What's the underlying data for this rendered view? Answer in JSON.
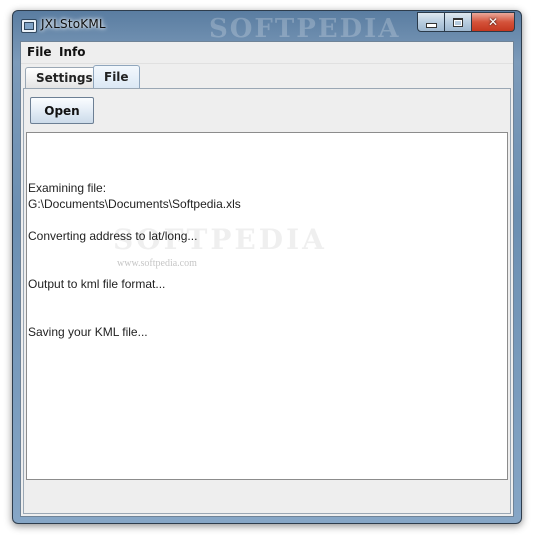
{
  "window": {
    "title": "JXLStoKML",
    "watermark": "SOFTPEDIA"
  },
  "menubar": {
    "items": [
      {
        "label": "File"
      },
      {
        "label": "Info"
      }
    ]
  },
  "tabs": [
    {
      "label": "Settings",
      "active": false
    },
    {
      "label": "File",
      "active": true
    }
  ],
  "file_tab": {
    "open_button_label": "Open",
    "log_lines": [
      "Examining file:",
      "G:\\Documents\\Documents\\Softpedia.xls",
      "Converting address to lat/long...",
      "Output to kml file format...",
      "Saving your KML file..."
    ],
    "watermark_text": "SOFTPEDIA",
    "watermark_url": "www.softpedia.com"
  }
}
